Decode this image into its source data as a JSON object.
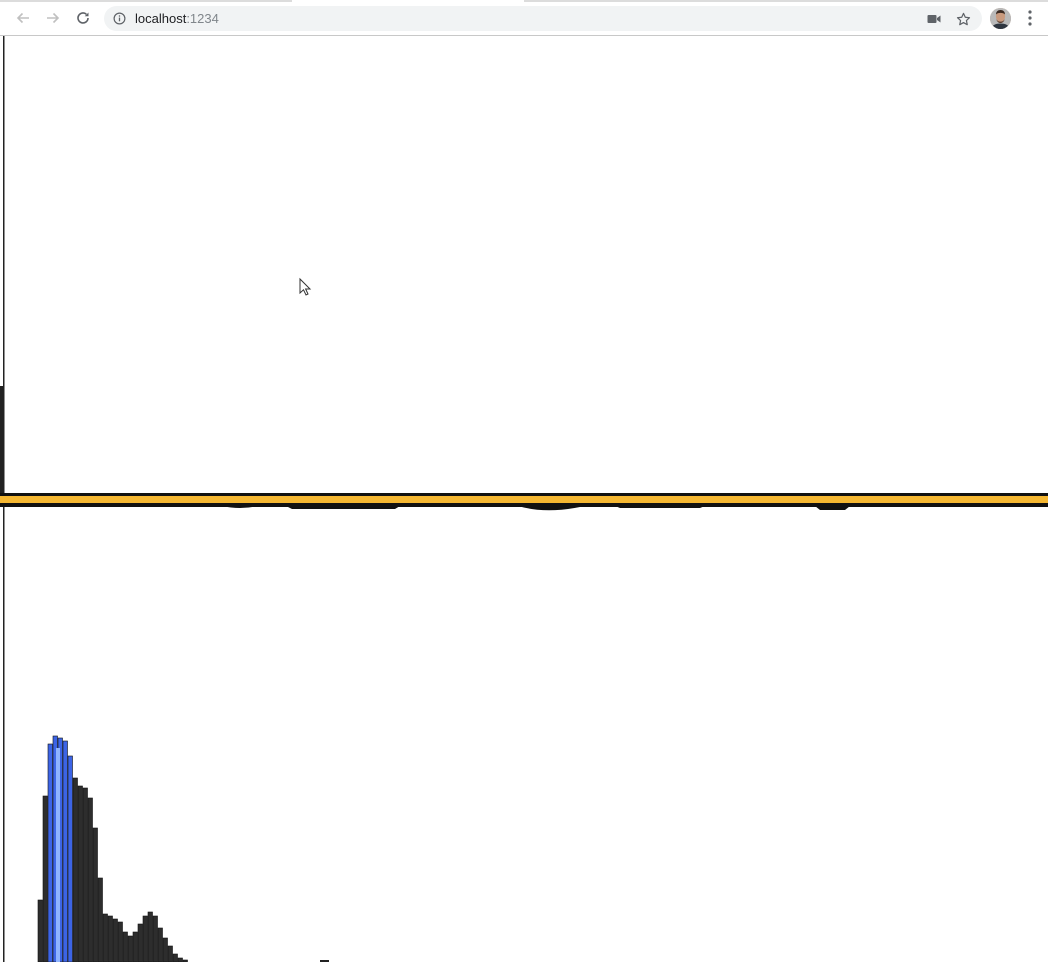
{
  "browser": {
    "address_bar": {
      "host": "localhost",
      "port": ":1234"
    },
    "icons": {
      "back": "back-arrow-icon",
      "forward": "forward-arrow-icon",
      "reload": "reload-icon",
      "info": "info-icon",
      "camera": "video-camera-icon",
      "bookmark": "star-icon",
      "profile": "avatar",
      "menu": "kebab-menu-icon"
    }
  },
  "canvas": {
    "divider_color": "#f5b731",
    "bar_color": "#2d2d2d",
    "highlight_color": "#3c64e6"
  }
}
